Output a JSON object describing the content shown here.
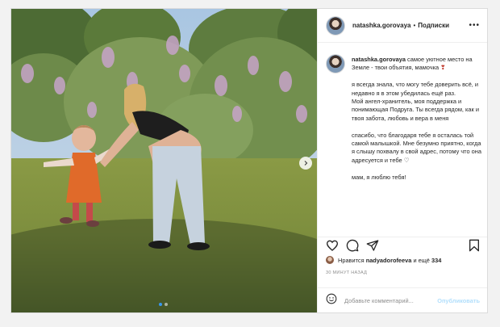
{
  "post": {
    "username": "natashka.gorovaya",
    "separator": "•",
    "follow_label": "Подписки",
    "more_label": "•••",
    "caption": {
      "username": "natashka.gorovaya",
      "line1": "самое уютное место на Земле - твои объятия, мамочка",
      "heart_emoji": "❣",
      "p2": "я всегда знала, что могу тебе доверить всё, и недавно я в этом убедилась ещё раз.",
      "p3": "Мой ангел-хранитель, моя поддержка и понимающая Подруга. Ты всегда рядом, как и твоя забота, любовь и вера в меня",
      "p4": "спасибо, что благодаря тебе я осталась той самой малышкой. Мне безумно приятно, когда я слышу похвалу в свой адрес, потому что она адресуется и тебе",
      "heart2": "♡",
      "p5": "мам, я люблю тебя!"
    },
    "likes": {
      "prefix": "Нравится",
      "user": "nadyadorofeeva",
      "conj": "и ещё",
      "count": "334"
    },
    "time": "30 МИНУТ НАЗАД",
    "comment": {
      "placeholder": "Добавьте комментарий...",
      "publish_label": "Опубликовать"
    },
    "carousel": {
      "slides": 2,
      "active": 0
    },
    "colors": {
      "link": "#3897f0",
      "publish_disabled": "#b2dffc",
      "border": "#dbdbdb",
      "text": "#262626",
      "muted": "#8e8e8e"
    },
    "icons": [
      "heart-icon",
      "comment-icon",
      "share-icon",
      "bookmark-icon",
      "emoji-icon",
      "chevron-right-icon"
    ]
  }
}
